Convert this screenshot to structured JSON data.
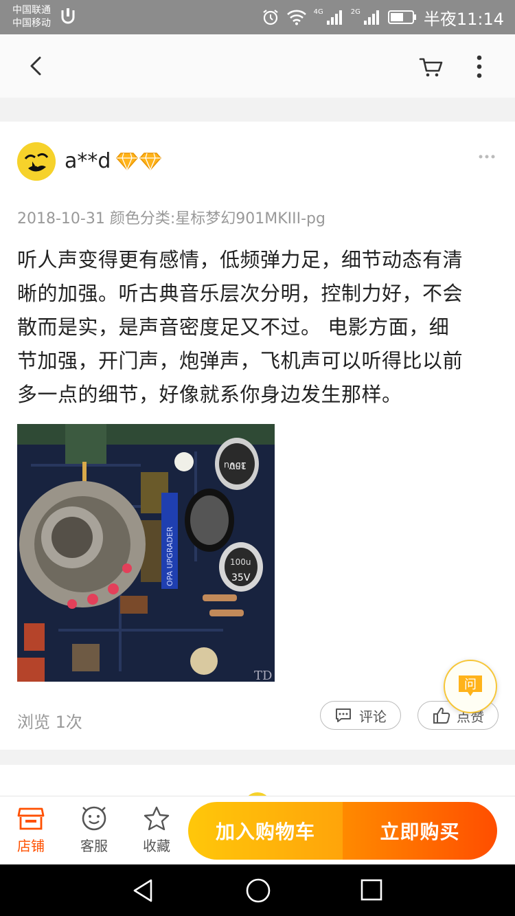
{
  "status_bar": {
    "carrier_1": "中国联通",
    "carrier_2": "中国移动",
    "net_1": "4G",
    "net_2": "2G",
    "time": "半夜11:14"
  },
  "header": {
    "back_icon": "chevron-left-icon",
    "cart_icon": "cart-icon",
    "more_icon": "more-vertical-icon"
  },
  "review": {
    "username": "a**d",
    "vip_level_icons": [
      "diamond-icon",
      "diamond-icon"
    ],
    "meta": "2018-10-31 颜色分类:星标梦幻901MKIII-pg",
    "text_lines": [
      "听人声变得更有感情，低频弹力足，细节动态有清",
      "晰的加强。听古典音乐层次分明，控制力好，不会",
      "散而是实，是声音密度足又不过。 电影方面，细",
      "节加强，开门声，炮弹声，飞机声可以听得比以前",
      "多一点的细节，好像就系你身边发生那样。"
    ],
    "photo_labels": {
      "cap_1_value": "100u",
      "cap_1_voltage": "35V",
      "cap_2_value": "100u",
      "cap_2_voltage": "35V",
      "board_text": "OPA UPGRADER",
      "corner_text": "TD"
    },
    "views": "浏览 1次",
    "comment_label": "评论",
    "like_label": "点赞",
    "ask_label": "问"
  },
  "bottom_bar": {
    "shop_label": "店铺",
    "service_label": "客服",
    "favorite_label": "收藏",
    "add_to_cart": "加入购物车",
    "buy_now": "立即购买"
  },
  "colors": {
    "accent": "#ff5000",
    "cart_button": "#ffb30a",
    "buy_button": "#ff6000",
    "status_bar": "#8c8c8c"
  }
}
